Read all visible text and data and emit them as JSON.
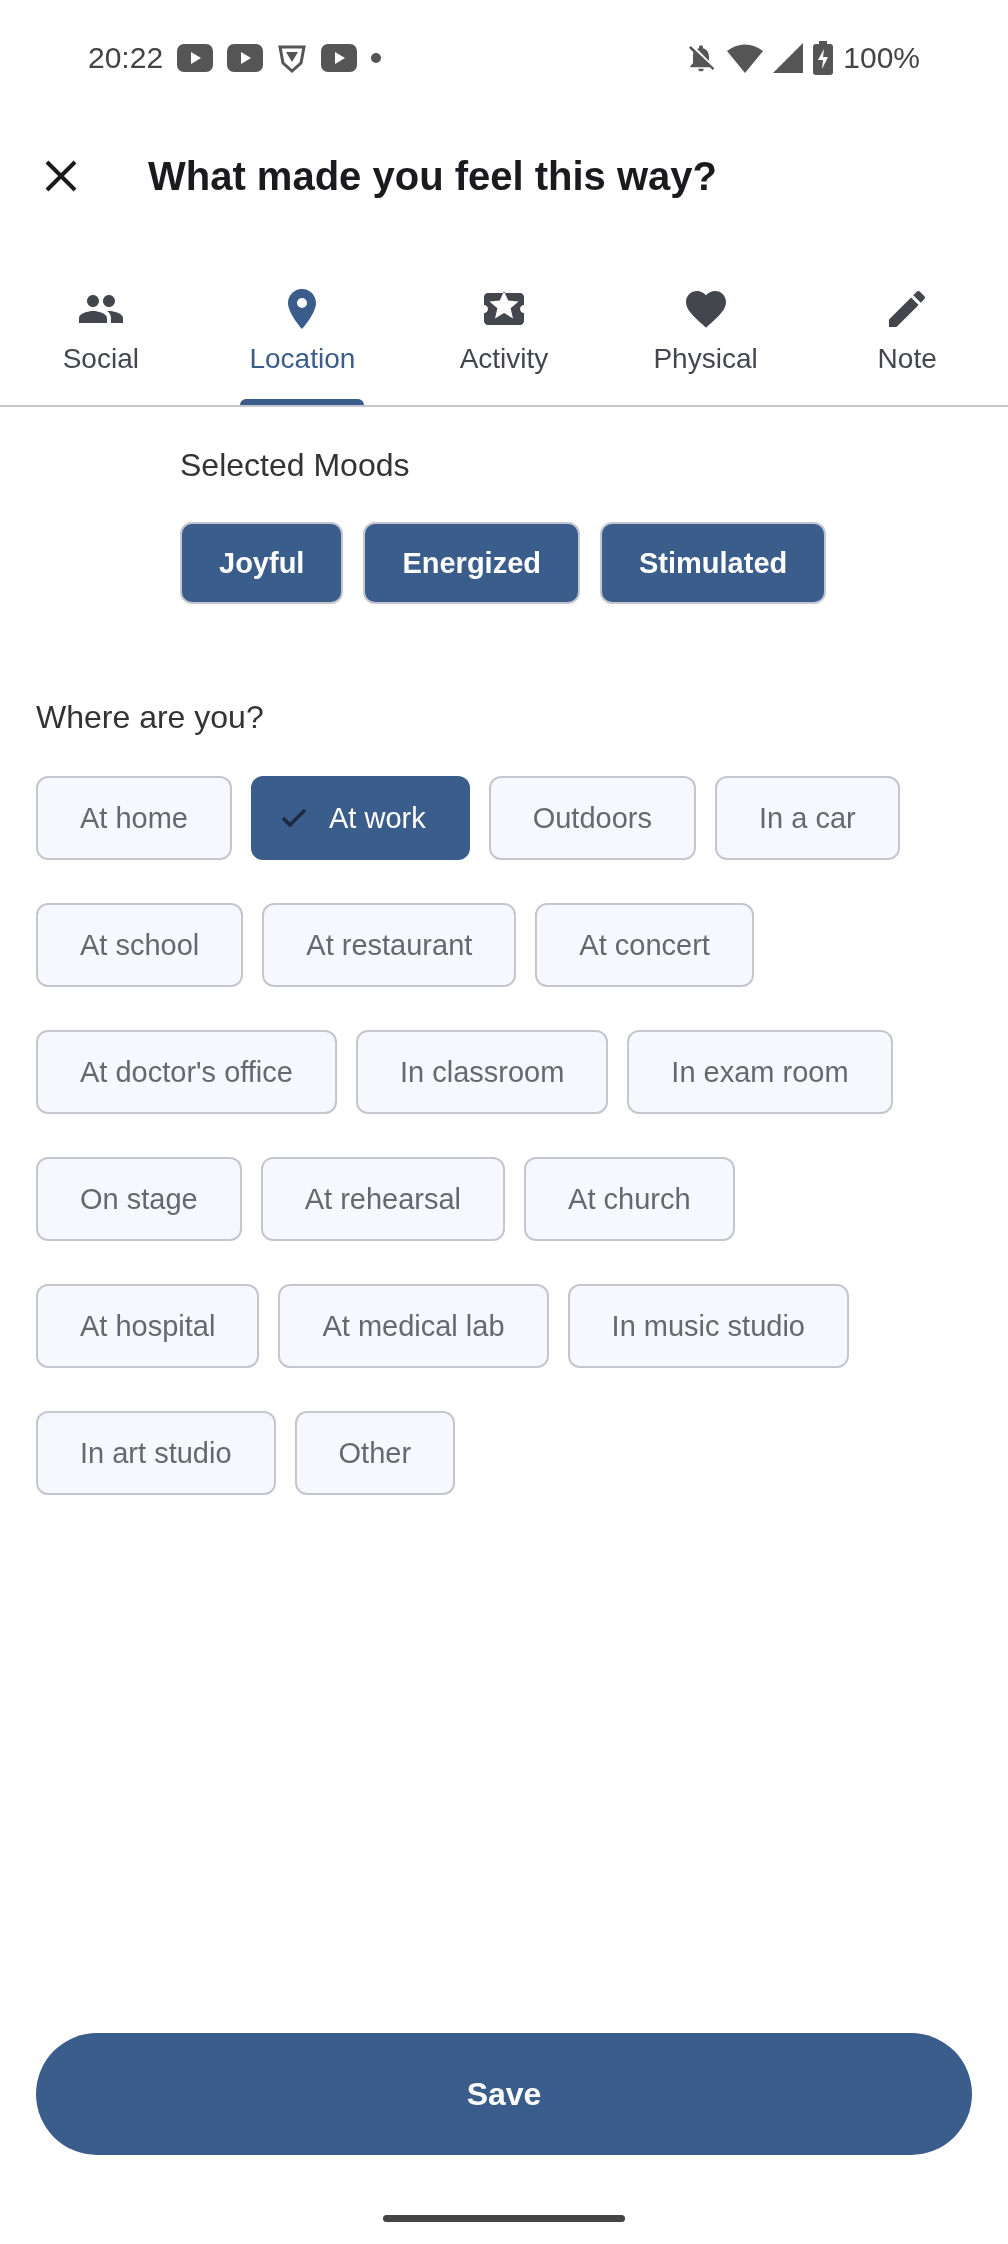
{
  "status_bar": {
    "time": "20:22",
    "battery": "100%"
  },
  "header": {
    "title": "What made you feel this way?"
  },
  "tabs": [
    {
      "label": "Social",
      "selected": false
    },
    {
      "label": "Location",
      "selected": true
    },
    {
      "label": "Activity",
      "selected": false
    },
    {
      "label": "Physical",
      "selected": false
    },
    {
      "label": "Note",
      "selected": false
    }
  ],
  "selected_moods": {
    "heading": "Selected Moods",
    "moods": [
      "Joyful",
      "Energized",
      "Stimulated"
    ]
  },
  "location": {
    "heading": "Where are you?",
    "options": [
      {
        "label": "At home",
        "selected": false
      },
      {
        "label": "At work",
        "selected": true
      },
      {
        "label": "Outdoors",
        "selected": false
      },
      {
        "label": "In a car",
        "selected": false
      },
      {
        "label": "At school",
        "selected": false
      },
      {
        "label": "At restaurant",
        "selected": false
      },
      {
        "label": "At concert",
        "selected": false
      },
      {
        "label": "At doctor's office",
        "selected": false
      },
      {
        "label": "In classroom",
        "selected": false
      },
      {
        "label": "In exam room",
        "selected": false
      },
      {
        "label": "On stage",
        "selected": false
      },
      {
        "label": "At rehearsal",
        "selected": false
      },
      {
        "label": "At church",
        "selected": false
      },
      {
        "label": "At hospital",
        "selected": false
      },
      {
        "label": "At medical lab",
        "selected": false
      },
      {
        "label": "In music studio",
        "selected": false
      },
      {
        "label": "In art studio",
        "selected": false
      },
      {
        "label": "Other",
        "selected": false
      }
    ]
  },
  "save_button": {
    "label": "Save"
  }
}
